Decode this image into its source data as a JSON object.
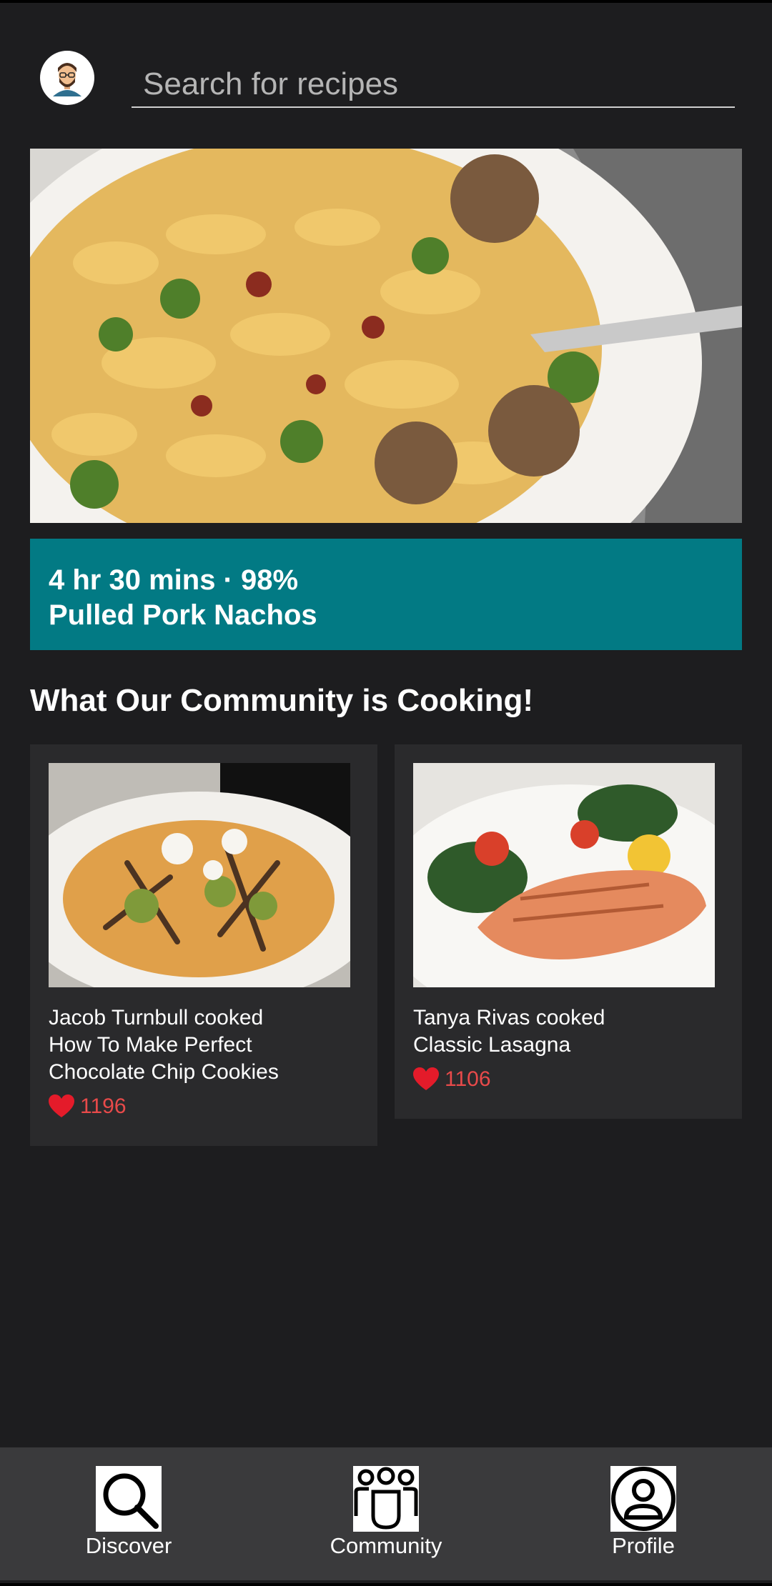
{
  "search": {
    "placeholder": "Search for recipes",
    "value": ""
  },
  "featured": {
    "meta": "4 hr 30 mins · 98%",
    "title": "Pulled Pork Nachos"
  },
  "community": {
    "title": "What Our Community is Cooking!",
    "cards": [
      {
        "text": "Jacob Turnbull cooked\nHow To Make Perfect\nChocolate Chip Cookies",
        "likes": "1196"
      },
      {
        "text": "Tanya Rivas cooked\nClassic Lasagna",
        "likes": "1106"
      }
    ]
  },
  "nav": {
    "items": [
      {
        "label": "Discover",
        "icon": "search-icon"
      },
      {
        "label": "Community",
        "icon": "community-icon"
      },
      {
        "label": "Profile",
        "icon": "profile-icon"
      }
    ]
  },
  "colors": {
    "background": "#1d1d1f",
    "banner": "#027a84",
    "card": "#2a2a2c",
    "nav": "#3a3a3c",
    "likes": "#e84a4a"
  }
}
